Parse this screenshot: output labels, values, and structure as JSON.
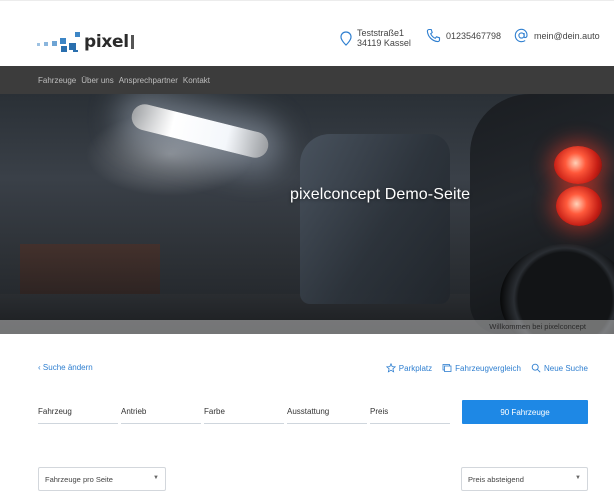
{
  "header": {
    "logo_text": "pixel",
    "address_line1": "Teststraße1",
    "address_line2": "34119 Kassel",
    "phone": "01235467798",
    "email": "mein@dein.auto",
    "icons": {
      "address": "map-pin-icon",
      "phone": "phone-icon",
      "email": "at-icon"
    }
  },
  "nav": {
    "items": [
      {
        "label": "Fahrzeuge"
      },
      {
        "label": "Über uns"
      },
      {
        "label": "Ansprechpartner"
      },
      {
        "label": "Kontakt"
      }
    ]
  },
  "hero": {
    "title": "pixelconcept Demo-Seite",
    "banner": "Willkommen bei pixelconcept"
  },
  "toolbar": {
    "back_label": "Suche ändern",
    "parkplatz_label": "Parkplatz",
    "compare_label": "Fahrzeugvergleich",
    "new_search_label": "Neue Suche"
  },
  "filters": {
    "fields": [
      {
        "label": "Fahrzeug"
      },
      {
        "label": "Antrieb"
      },
      {
        "label": "Farbe"
      },
      {
        "label": "Ausstattung"
      },
      {
        "label": "Preis"
      }
    ],
    "result_button": "90 Fahrzeuge"
  },
  "controls": {
    "per_page_label": "Fahrzeuge pro Seite",
    "sort_label": "Preis absteigend"
  },
  "colors": {
    "accent": "#1e88e5",
    "nav_bg": "#3c3c3c",
    "link": "#2f7fd0"
  }
}
